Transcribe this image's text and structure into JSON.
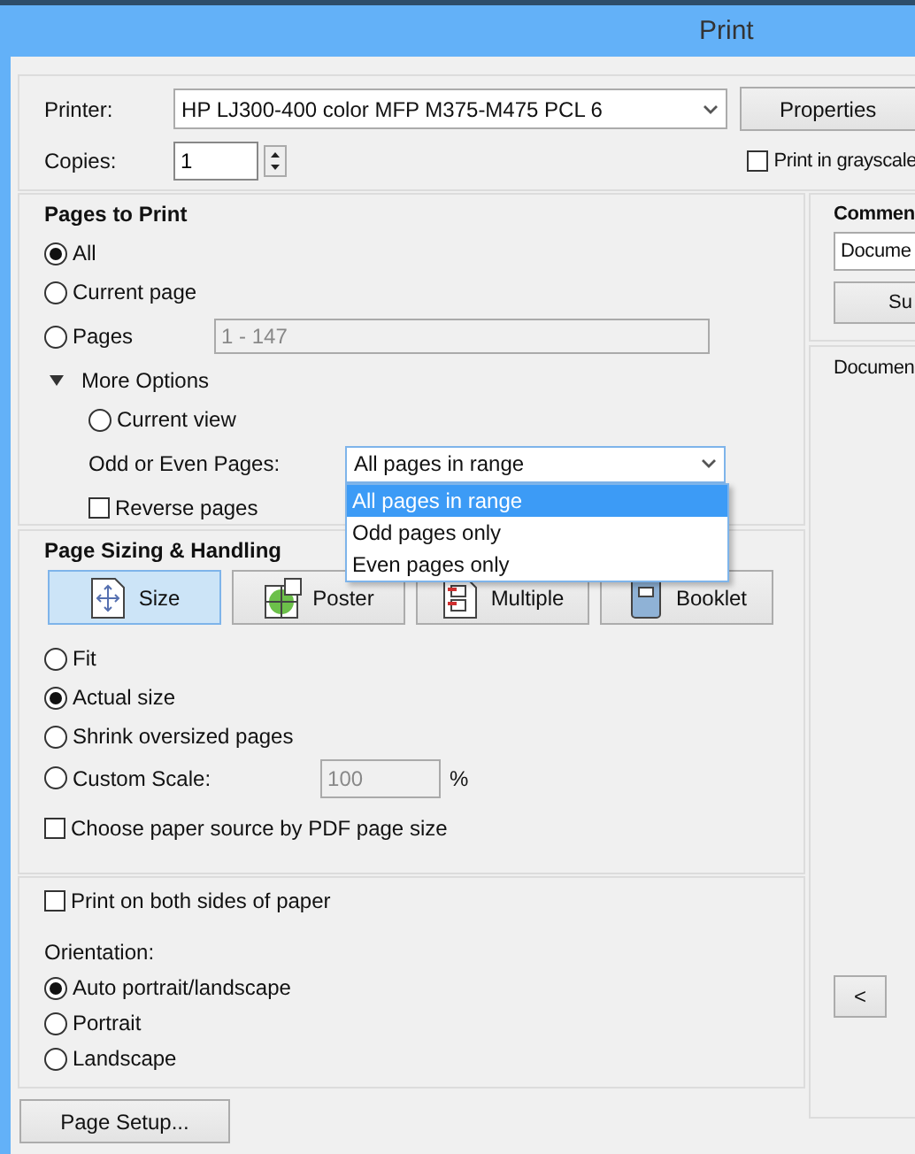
{
  "window": {
    "title": "Print"
  },
  "printer": {
    "label": "Printer:",
    "value": "HP LJ300-400 color MFP M375-M475 PCL 6",
    "properties_button": "Properties"
  },
  "copies": {
    "label": "Copies:",
    "value": "1"
  },
  "grayscale": {
    "label": "Print in grayscale",
    "checked": false
  },
  "pages_to_print": {
    "title": "Pages to Print",
    "options": [
      {
        "label": "All",
        "selected": true
      },
      {
        "label": "Current page",
        "selected": false
      },
      {
        "label": "Pages",
        "selected": false,
        "range": "1 - 147",
        "disabled": true
      }
    ],
    "more_options": {
      "label": "More Options",
      "expanded": true,
      "current_view": {
        "label": "Current view",
        "selected": false
      },
      "odd_even": {
        "label": "Odd or Even Pages:",
        "value": "All pages in range",
        "open": true,
        "options": [
          {
            "label": "All pages in range",
            "selected": true
          },
          {
            "label": "Odd pages only",
            "selected": false
          },
          {
            "label": "Even pages only",
            "selected": false
          }
        ]
      },
      "reverse": {
        "label": "Reverse pages",
        "checked": false
      }
    }
  },
  "page_sizing": {
    "title": "Page Sizing & Handling",
    "modes": [
      {
        "label": "Size",
        "kind": "size",
        "selected": true
      },
      {
        "label": "Poster",
        "kind": "poster",
        "selected": false
      },
      {
        "label": "Multiple",
        "kind": "multiple",
        "selected": false
      },
      {
        "label": "Booklet",
        "kind": "booklet",
        "selected": false
      }
    ],
    "options": [
      {
        "label": "Fit",
        "selected": false
      },
      {
        "label": "Actual size",
        "selected": true
      },
      {
        "label": "Shrink oversized pages",
        "selected": false
      },
      {
        "label": "Custom Scale:",
        "selected": false,
        "scale": "100",
        "unit": "%",
        "disabled": true
      }
    ],
    "paper_source": {
      "label": "Choose paper source by PDF page size",
      "checked": false
    }
  },
  "duplex": {
    "label": "Print on both sides of paper",
    "checked": false
  },
  "orientation": {
    "label": "Orientation:",
    "options": [
      {
        "label": "Auto portrait/landscape",
        "selected": true
      },
      {
        "label": "Portrait",
        "selected": false
      },
      {
        "label": "Landscape",
        "selected": false
      }
    ]
  },
  "page_setup_button": "Page Setup...",
  "comments": {
    "title": "Commen",
    "value": "Docume",
    "button": "Su"
  },
  "preview": {
    "label": "Documen",
    "nav_button": "<"
  }
}
